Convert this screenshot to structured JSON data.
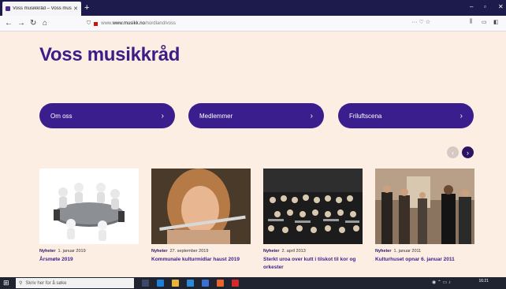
{
  "browser": {
    "tab_title": "Voss musikkråd – Voss musikk",
    "new_tab": "+",
    "url_host": "www.musikk.no",
    "url_path": "/nordland/voss",
    "url_prefix": "www."
  },
  "site": {
    "title": "Voss musikkråd"
  },
  "nav": [
    {
      "label": "Om oss"
    },
    {
      "label": "Medlemmer"
    },
    {
      "label": "Friluftscena"
    }
  ],
  "news": [
    {
      "category": "Nyheter",
      "date": "1. januar 2019",
      "title": "Årsmøte 2019"
    },
    {
      "category": "Nyheter",
      "date": "27. september 2019",
      "title": "Kommunale kulturmidlar haust 2019"
    },
    {
      "category": "Nyheter",
      "date": "2. april 2013",
      "title": "Sterkt uroa over kutt i tilskot til kor og orkester"
    },
    {
      "category": "Nyheter",
      "date": "1. januar 2011",
      "title": "Kulturhuset opnar 6. januar 2011"
    }
  ],
  "taskbar": {
    "search_placeholder": "Skriv her for å søke",
    "time": "16:21"
  },
  "icons": {
    "chevron": "›",
    "prev": "‹",
    "next": "›"
  },
  "colors": {
    "brand": "#3b1e8e",
    "background": "#fdeee4"
  }
}
